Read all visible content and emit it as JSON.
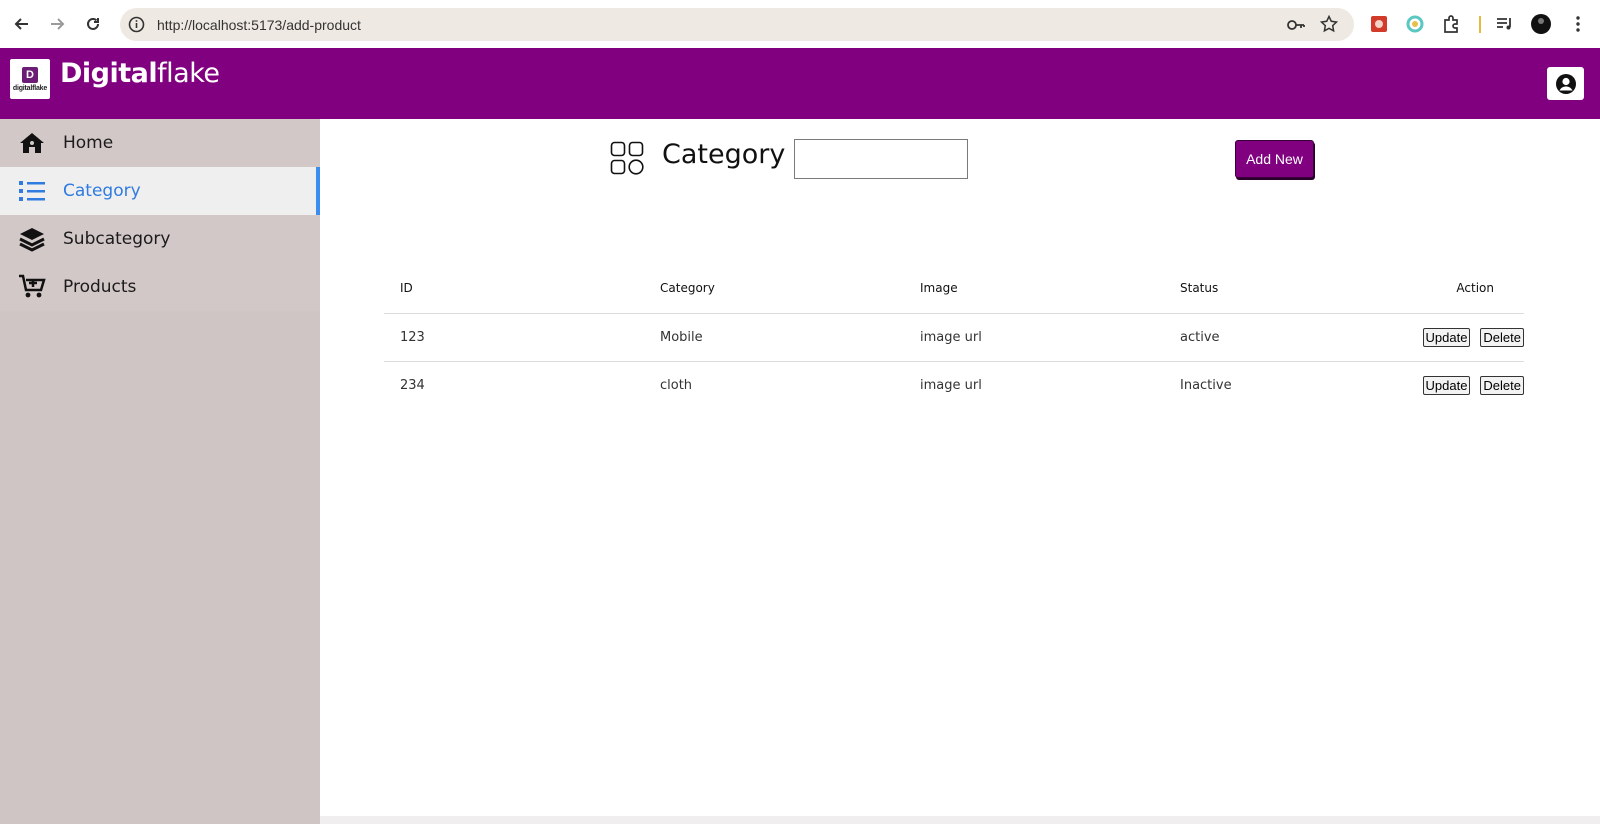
{
  "browser": {
    "url": "http://localhost:5173/add-product"
  },
  "header": {
    "logo_small_text": "digitalflake",
    "brand_bold": "Digital",
    "brand_light": "flake"
  },
  "sidebar": {
    "items": [
      {
        "label": "Home",
        "icon": "home-icon",
        "active": false
      },
      {
        "label": "Category",
        "icon": "list-icon",
        "active": true
      },
      {
        "label": "Subcategory",
        "icon": "layers-icon",
        "active": false
      },
      {
        "label": "Products",
        "icon": "cart-plus-icon",
        "active": false
      }
    ]
  },
  "main": {
    "title": "Category",
    "search_value": "",
    "add_button": "Add New",
    "table": {
      "headers": [
        "ID",
        "Category",
        "Image",
        "Status",
        "Action"
      ],
      "rows": [
        {
          "id": "123",
          "category": "Mobile",
          "image": "image url",
          "status": "active",
          "update": "Update",
          "delete": "Delete"
        },
        {
          "id": "234",
          "category": "cloth",
          "image": "image url",
          "status": "Inactive",
          "update": "Update",
          "delete": "Delete"
        }
      ]
    }
  },
  "colors": {
    "brand": "#800080",
    "sidebar": "#d3c8c8",
    "active_accent": "#3b8ef0"
  }
}
